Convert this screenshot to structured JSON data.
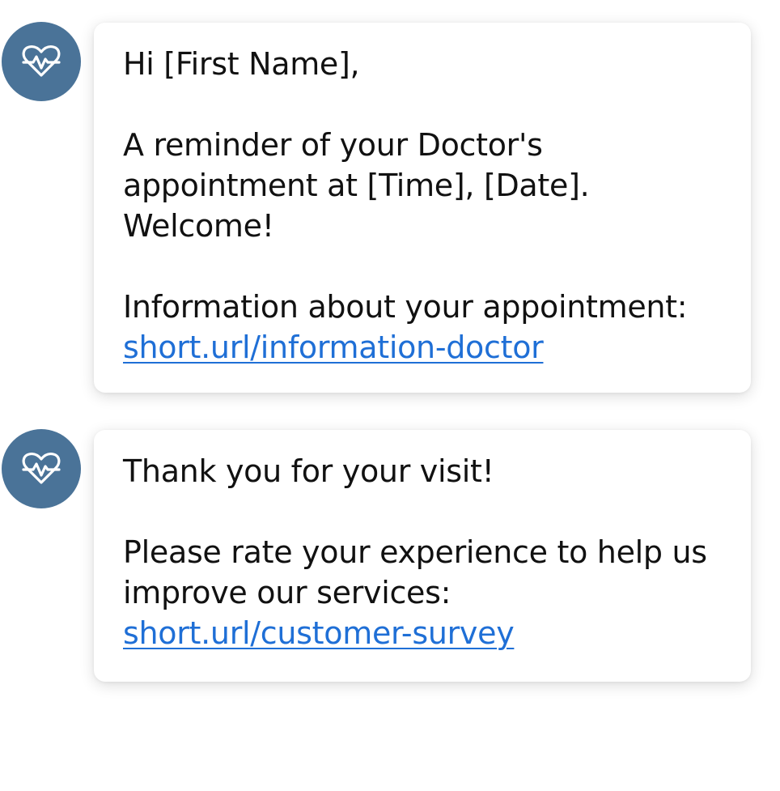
{
  "colors": {
    "avatar_bg": "#4a7398",
    "link": "#1f6fd6",
    "text": "#111111"
  },
  "messages": [
    {
      "avatar_icon": "heartbeat-icon",
      "lines": [
        "Hi [First Name],",
        "A reminder of your Doctor's",
        "appointment at [Time], [Date].",
        "Welcome!",
        "Information about your appointment:"
      ],
      "link": "short.url/information-doctor"
    },
    {
      "avatar_icon": "heartbeat-icon",
      "lines": [
        "Thank you for your visit!",
        "Please rate your experience to help us",
        "improve our services:"
      ],
      "link": "short.url/customer-survey"
    }
  ]
}
